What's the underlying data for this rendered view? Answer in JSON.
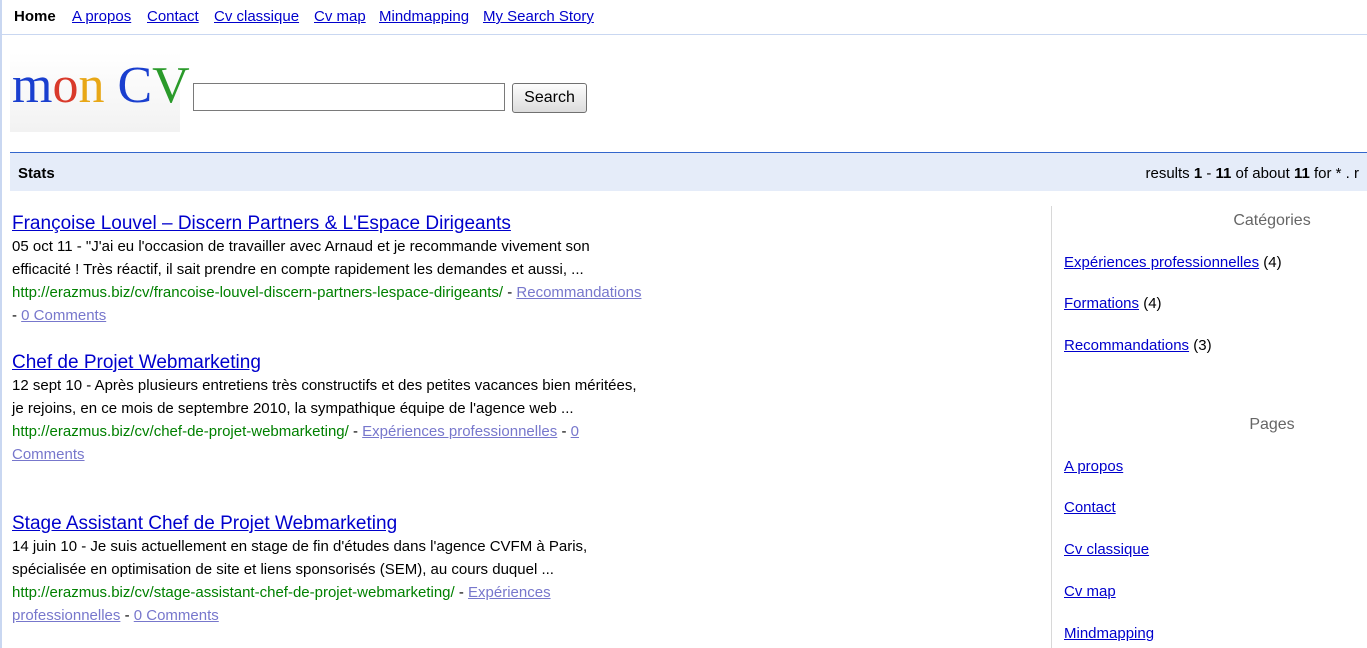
{
  "nav": {
    "home": "Home",
    "links": [
      "A propos",
      "Contact",
      "Cv classique",
      "Cv map",
      "Mindmapping",
      "My Search Story"
    ]
  },
  "logo": {
    "m": "m",
    "o": "o",
    "n": "n",
    "c": "C",
    "v": "V"
  },
  "search": {
    "value": "",
    "button": "Search"
  },
  "stats": {
    "label": "Stats",
    "prefix": "results ",
    "from": "1",
    "sep": " - ",
    "to": "11",
    "about": " of about ",
    "total": "11",
    "suffix": " for * . r"
  },
  "results": [
    {
      "title": "Françoise Louvel – Discern Partners & L'Espace Dirigeants",
      "snippet": "05 oct 11 - \"J'ai eu l'occasion de travailler avec Arnaud et je recommande vivement son efficacité ! Très réactif, il sait prendre en compte rapidement les demandes et aussi, ...",
      "url": "http://erazmus.biz/cv/francoise-louvel-discern-partners-lespace-dirigeants/",
      "category": "Recommandations",
      "comments": "0 Comments"
    },
    {
      "title": "Chef de Projet Webmarketing",
      "snippet": "12 sept 10 - Après plusieurs entretiens très constructifs et des petites vacances bien méritées, je rejoins, en ce mois de septembre 2010, la sympathique équipe de l'agence web ...",
      "url": "http://erazmus.biz/cv/chef-de-projet-webmarketing/",
      "category": "Expériences professionnelles",
      "comments": "0 Comments"
    },
    {
      "title": "Stage Assistant Chef de Projet Webmarketing",
      "snippet": "14 juin 10 - Je suis actuellement en stage de fin d'études dans l'agence CVFM à Paris, spécialisée en optimisation de site et liens sponsorisés (SEM), au cours duquel ...",
      "url": "http://erazmus.biz/cv/stage-assistant-chef-de-projet-webmarketing/",
      "category": "Expériences professionnelles",
      "comments": "0 Comments"
    }
  ],
  "sidebar": {
    "categories_title": "Catégories",
    "categories": [
      {
        "label": "Expériences professionnelles",
        "count": " (4)"
      },
      {
        "label": "Formations",
        "count": " (4)"
      },
      {
        "label": "Recommandations",
        "count": " (3)"
      }
    ],
    "pages_title": "Pages",
    "pages": [
      "A propos",
      "Contact",
      "Cv classique",
      "Cv map",
      "Mindmapping"
    ]
  },
  "colors": {
    "url": "#008000",
    "link": "#0000cc",
    "statsbar": "#e5ecf9"
  }
}
